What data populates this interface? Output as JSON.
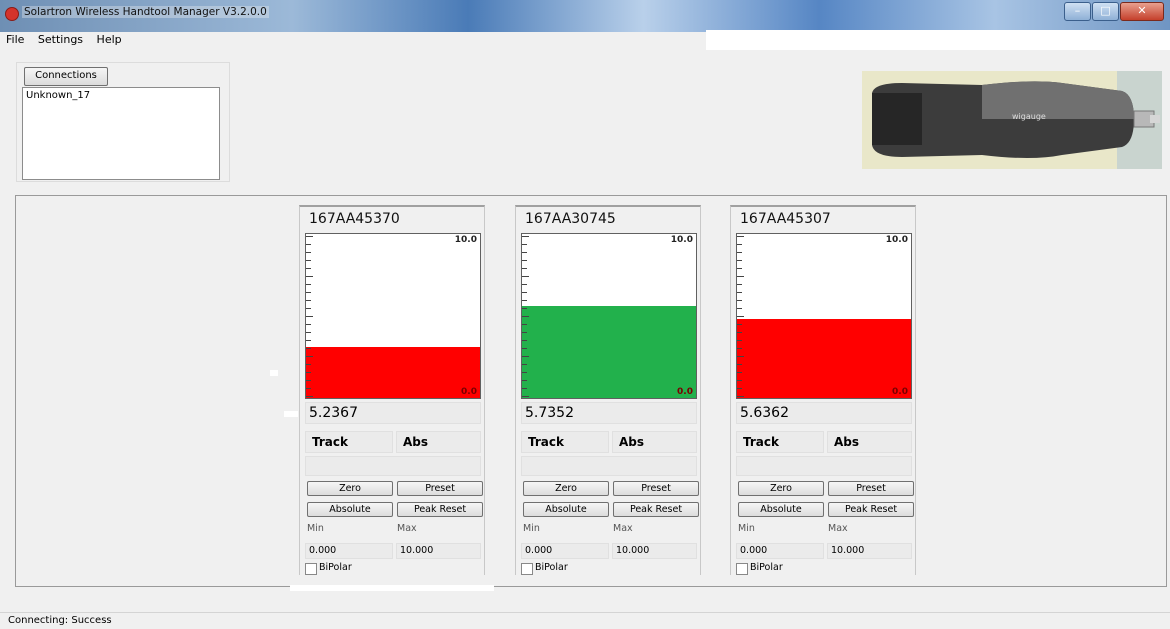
{
  "window": {
    "title": "Solartron Wireless Handtool Manager  V3.2.0.0",
    "min_icon": "minimize-icon",
    "max_icon": "maximize-icon",
    "close_icon": "close-icon"
  },
  "menu": {
    "file": "File",
    "settings": "Settings",
    "help": "Help"
  },
  "connections": {
    "button_label": "Connections",
    "items": [
      "Unknown_17"
    ]
  },
  "device_image": {
    "label": "wigauge"
  },
  "gauges": [
    {
      "id": "167AA45370",
      "value": "5.2367",
      "mode_track": "Track",
      "mode_abs": "Abs",
      "scale_max": "10.0",
      "scale_min": "0.0",
      "level_fraction": 0.31,
      "fill_color": "#ff0000",
      "zero": "Zero",
      "preset": "Preset",
      "absolute": "Absolute",
      "peak_reset": "Peak Reset",
      "min_label": "Min",
      "max_label": "Max",
      "min_value": "0.000",
      "max_value": "10.000",
      "bipolar": "BiPolar"
    },
    {
      "id": "167AA30745",
      "value": "5.7352",
      "mode_track": "Track",
      "mode_abs": "Abs",
      "scale_max": "10.0",
      "scale_min": "0.0",
      "level_fraction": 0.56,
      "fill_color": "#22b14c",
      "zero": "Zero",
      "preset": "Preset",
      "absolute": "Absolute",
      "peak_reset": "Peak Reset",
      "min_label": "Min",
      "max_label": "Max",
      "min_value": "0.000",
      "max_value": "10.000",
      "bipolar": "BiPolar"
    },
    {
      "id": "167AA45307",
      "value": "5.6362",
      "mode_track": "Track",
      "mode_abs": "Abs",
      "scale_max": "10.0",
      "scale_min": "0.0",
      "level_fraction": 0.48,
      "fill_color": "#ff0000",
      "zero": "Zero",
      "preset": "Preset",
      "absolute": "Absolute",
      "peak_reset": "Peak Reset",
      "min_label": "Min",
      "max_label": "Max",
      "min_value": "0.000",
      "max_value": "10.000",
      "bipolar": "BiPolar"
    }
  ],
  "status": {
    "text": "Connecting: Success"
  }
}
